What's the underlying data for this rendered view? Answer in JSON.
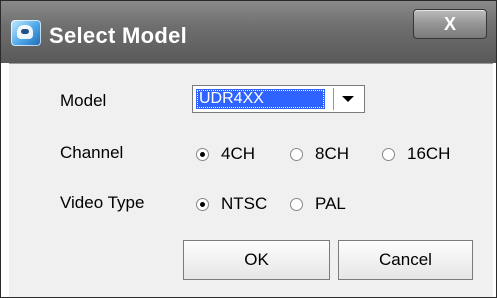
{
  "window": {
    "title": "Select Model",
    "close_label": "X",
    "icon": "app-icon"
  },
  "form": {
    "model": {
      "label": "Model",
      "value": "UDR4XX"
    },
    "channel": {
      "label": "Channel",
      "options": [
        {
          "label": "4CH",
          "checked": true
        },
        {
          "label": "8CH",
          "checked": false
        },
        {
          "label": "16CH",
          "checked": false
        }
      ]
    },
    "video_type": {
      "label": "Video Type",
      "options": [
        {
          "label": "NTSC",
          "checked": true
        },
        {
          "label": "PAL",
          "checked": false
        }
      ]
    }
  },
  "buttons": {
    "ok": "OK",
    "cancel": "Cancel"
  },
  "colors": {
    "selection": "#2f63ff",
    "title_bar": "#6f6f6f"
  }
}
